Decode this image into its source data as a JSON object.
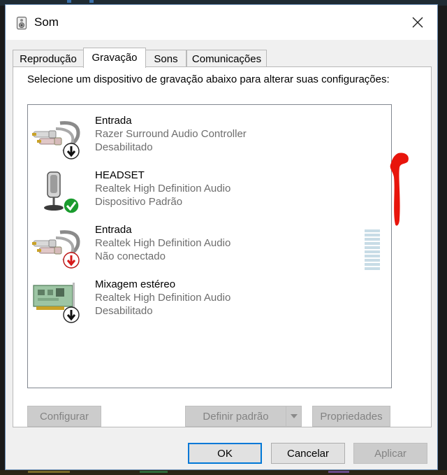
{
  "window": {
    "title": "Som",
    "icon": "speaker-icon",
    "close_icon": "close-icon"
  },
  "tabs": [
    {
      "label": "Reprodução",
      "active": false
    },
    {
      "label": "Gravação",
      "active": true
    },
    {
      "label": "Sons",
      "active": false
    },
    {
      "label": "Comunicações",
      "active": false
    }
  ],
  "panel": {
    "instruction": "Selecione um dispositivo de gravação abaixo para alterar suas configurações:"
  },
  "devices": [
    {
      "name": "Entrada",
      "driver": "Razer Surround Audio Controller",
      "status": "Desabilitado",
      "icon": "rca-cable-icon",
      "badge": "down-arrow-badge-icon"
    },
    {
      "name": "HEADSET",
      "driver": "Realtek High Definition Audio",
      "status": "Dispositivo Padrão",
      "icon": "headset-microphone-icon",
      "badge": "green-check-badge-icon"
    },
    {
      "name": "Entrada",
      "driver": "Realtek High Definition Audio",
      "status": "Não conectado",
      "icon": "rca-cable-icon",
      "badge": "red-arrow-badge-icon"
    },
    {
      "name": "Mixagem estéreo",
      "driver": "Realtek High Definition Audio",
      "status": "Desabilitado",
      "icon": "sound-card-icon",
      "badge": "down-arrow-badge-icon"
    }
  ],
  "level_meter": {
    "bars": 10,
    "level": 0.0
  },
  "panel_buttons": {
    "configure": "Configurar",
    "set_default": "Definir padrão",
    "properties": "Propriedades"
  },
  "dialog_buttons": {
    "ok": "OK",
    "cancel": "Cancelar",
    "apply": "Aplicar"
  },
  "colors": {
    "accent": "#0078d7",
    "default_badge": "#1a9b2d",
    "not_connected_badge": "#d71a1a",
    "level_meter": "#c8dce6",
    "annotation": "#e8150c"
  }
}
